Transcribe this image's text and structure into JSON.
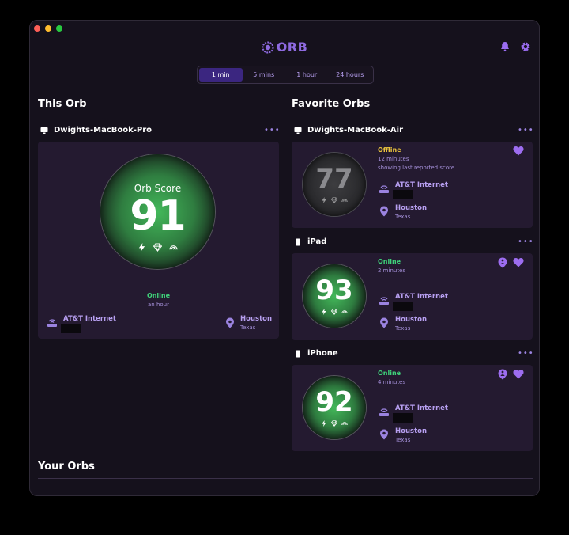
{
  "brand": {
    "name": "ORB"
  },
  "time_ranges": [
    {
      "label": "1 min",
      "active": true
    },
    {
      "label": "5 mins",
      "active": false
    },
    {
      "label": "1 hour",
      "active": false
    },
    {
      "label": "24 hours",
      "active": false
    }
  ],
  "this_orb": {
    "title": "This Orb",
    "device": {
      "name": "Dwights-MacBook-Pro",
      "score_label": "Orb Score",
      "score": "91",
      "status": "Online",
      "status_sub": "an hour",
      "isp": "AT&T Internet",
      "city": "Houston",
      "region": "Texas",
      "more": "•••"
    }
  },
  "favorites": {
    "title": "Favorite Orbs",
    "devices": [
      {
        "name": "Dwights-MacBook-Air",
        "score": "77",
        "status": "Offline",
        "status_sub": "12 minutes",
        "note": "showing last reported score",
        "isp": "AT&T Internet",
        "city": "Houston",
        "region": "Texas",
        "more": "•••"
      },
      {
        "name": "iPad",
        "score": "93",
        "status": "Online",
        "status_sub": "2 minutes",
        "isp": "AT&T Internet",
        "city": "Houston",
        "region": "Texas",
        "more": "•••"
      },
      {
        "name": "iPhone",
        "score": "92",
        "status": "Online",
        "status_sub": "4 minutes",
        "isp": "AT&T Internet",
        "city": "Houston",
        "region": "Texas",
        "more": "•••"
      }
    ]
  },
  "your_orbs": {
    "title": "Your Orbs"
  },
  "colors": {
    "accent": "#8e6ae0",
    "online": "#3fd27a",
    "offline": "#e8c23d",
    "card": "#241a30",
    "background": "#15111c"
  }
}
